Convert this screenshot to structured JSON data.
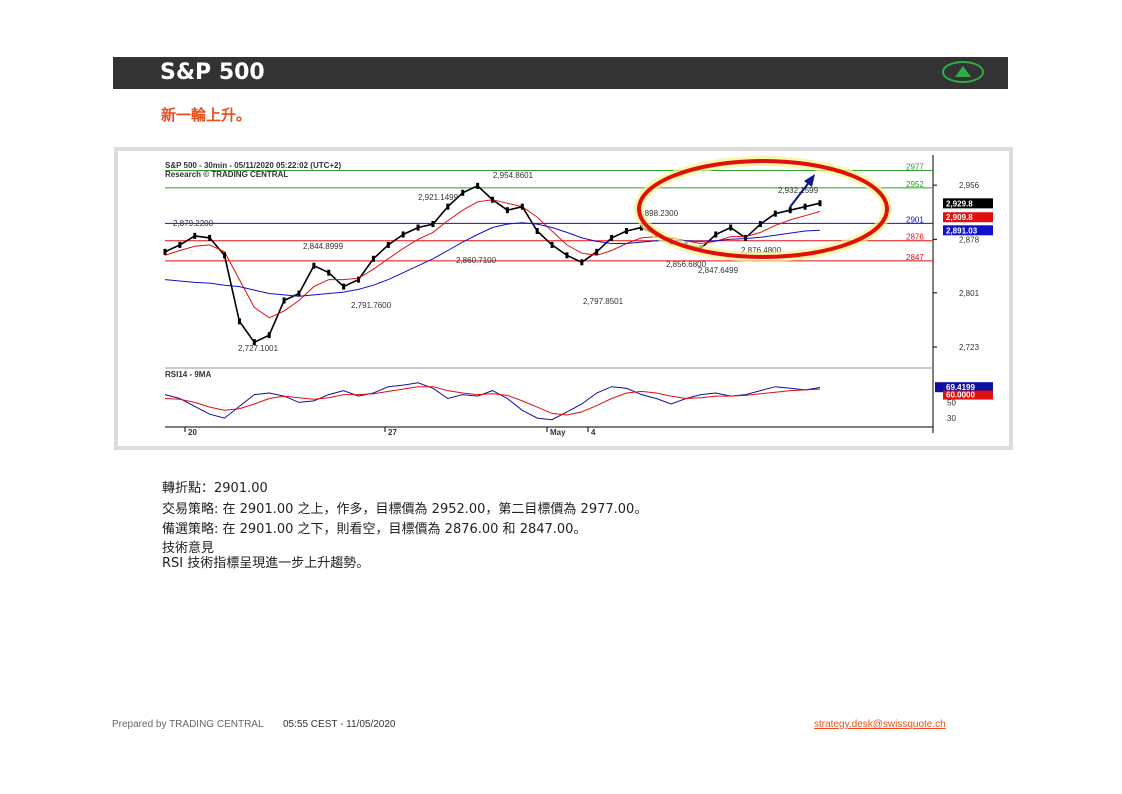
{
  "header": {
    "title": "S&P 500",
    "up_icon": "up-triangle-icon",
    "accent": "#2fae4b"
  },
  "subtitle": "新一輪上升。",
  "chart_header": {
    "line1": "S&P 500 - 30min - 05/11/2020 05:22:02 (UTC+2)",
    "line2": "Research © TRADING CENTRAL"
  },
  "chart_data": {
    "type": "line",
    "title": "S&P 500 - 30min - 05/11/2020 05:22:02 (UTC+2)",
    "price_ticks": [
      "2,956",
      "2,878",
      "2,801",
      "2,723"
    ],
    "levels": [
      {
        "label": "2977",
        "value": 2977,
        "color": "#2e9e2e"
      },
      {
        "label": "2952",
        "value": 2952,
        "color": "#2e9e2e"
      },
      {
        "label": "2901",
        "value": 2901,
        "color": "#1010d0"
      },
      {
        "label": "2876",
        "value": 2876,
        "color": "#e01010"
      },
      {
        "label": "2847",
        "value": 2847,
        "color": "#e01010"
      }
    ],
    "price_tags": [
      {
        "label": "2,929.8",
        "bg": "#000000"
      },
      {
        "label": "2,909.8",
        "bg": "#e01010"
      },
      {
        "label": "2,891.03",
        "bg": "#1010d0"
      }
    ],
    "annotations": [
      "2,954.8601",
      "2,921.1499",
      "2,879.2200",
      "2,844.8999",
      "2,860.7100",
      "2,791.7600",
      "2,727.1001",
      "2,898.2300",
      "2,932.1599",
      "2,876.4800",
      "2,856.6800",
      "2,847.6499",
      "2,797.8501"
    ],
    "series": [
      {
        "name": "price",
        "values": [
          2860,
          2870,
          2883,
          2880,
          2855,
          2760,
          2730,
          2740,
          2790,
          2800,
          2840,
          2830,
          2810,
          2820,
          2850,
          2870,
          2885,
          2895,
          2900,
          2925,
          2945,
          2955,
          2935,
          2920,
          2925,
          2890,
          2870,
          2855,
          2845,
          2860,
          2880,
          2890,
          2895,
          2885,
          2875,
          2870,
          2865,
          2885,
          2895,
          2880,
          2900,
          2915,
          2920,
          2925,
          2930
        ]
      },
      {
        "name": "ma-red",
        "values": [
          2855,
          2862,
          2868,
          2870,
          2860,
          2820,
          2780,
          2765,
          2775,
          2790,
          2810,
          2820,
          2820,
          2822,
          2835,
          2850,
          2865,
          2878,
          2888,
          2905,
          2920,
          2932,
          2935,
          2930,
          2925,
          2910,
          2890,
          2870,
          2858,
          2855,
          2862,
          2872,
          2880,
          2882,
          2880,
          2876,
          2872,
          2875,
          2882,
          2882,
          2888,
          2898,
          2906,
          2912,
          2918
        ]
      },
      {
        "name": "ma-blue",
        "values": [
          2820,
          2818,
          2816,
          2815,
          2812,
          2810,
          2805,
          2800,
          2798,
          2796,
          2798,
          2800,
          2802,
          2806,
          2812,
          2820,
          2830,
          2840,
          2850,
          2862,
          2874,
          2885,
          2895,
          2900,
          2902,
          2900,
          2895,
          2888,
          2880,
          2875,
          2872,
          2872,
          2874,
          2876,
          2876,
          2876,
          2875,
          2876,
          2878,
          2879,
          2881,
          2884,
          2887,
          2890,
          2891
        ]
      }
    ],
    "rsi": {
      "label": "RSI14 - 9MA",
      "ticks": [
        "50",
        "30"
      ],
      "tag": "69.4199",
      "tag2": "60.0000",
      "values": [
        60,
        55,
        45,
        35,
        30,
        45,
        60,
        62,
        58,
        50,
        52,
        60,
        65,
        58,
        62,
        70,
        72,
        75,
        68,
        55,
        60,
        58,
        65,
        55,
        40,
        30,
        28,
        38,
        48,
        62,
        70,
        68,
        60,
        55,
        48,
        55,
        60,
        62,
        58,
        60,
        65,
        70,
        68,
        66,
        69
      ],
      "ma": [
        55,
        54,
        50,
        44,
        40,
        42,
        48,
        55,
        58,
        56,
        54,
        56,
        60,
        60,
        61,
        64,
        67,
        70,
        70,
        65,
        62,
        60,
        61,
        59,
        52,
        44,
        36,
        34,
        38,
        46,
        55,
        62,
        64,
        62,
        58,
        55,
        56,
        58,
        58,
        59,
        61,
        63,
        65,
        66,
        67
      ]
    },
    "date_labels": [
      "20",
      "27",
      "May",
      "4"
    ]
  },
  "analysis": {
    "pivot": "轉折點：2901.00",
    "strategy": "交易策略: 在 2901.00 之上，作多，目標價為  2952.00，第二目標價為 2977.00。",
    "alternative": "備選策略: 在 2901.00 之下，則看空，目標價為  2876.00 和 2847.00。",
    "comment_title": "技術意見",
    "comment": "RSI 技術指標呈現進一步上升趨勢。"
  },
  "footer": {
    "prepared": "Prepared by TRADING CENTRAL",
    "timestamp": "05:55 CEST - 11/05/2020",
    "email": "strategy.desk@swissquote.ch"
  }
}
